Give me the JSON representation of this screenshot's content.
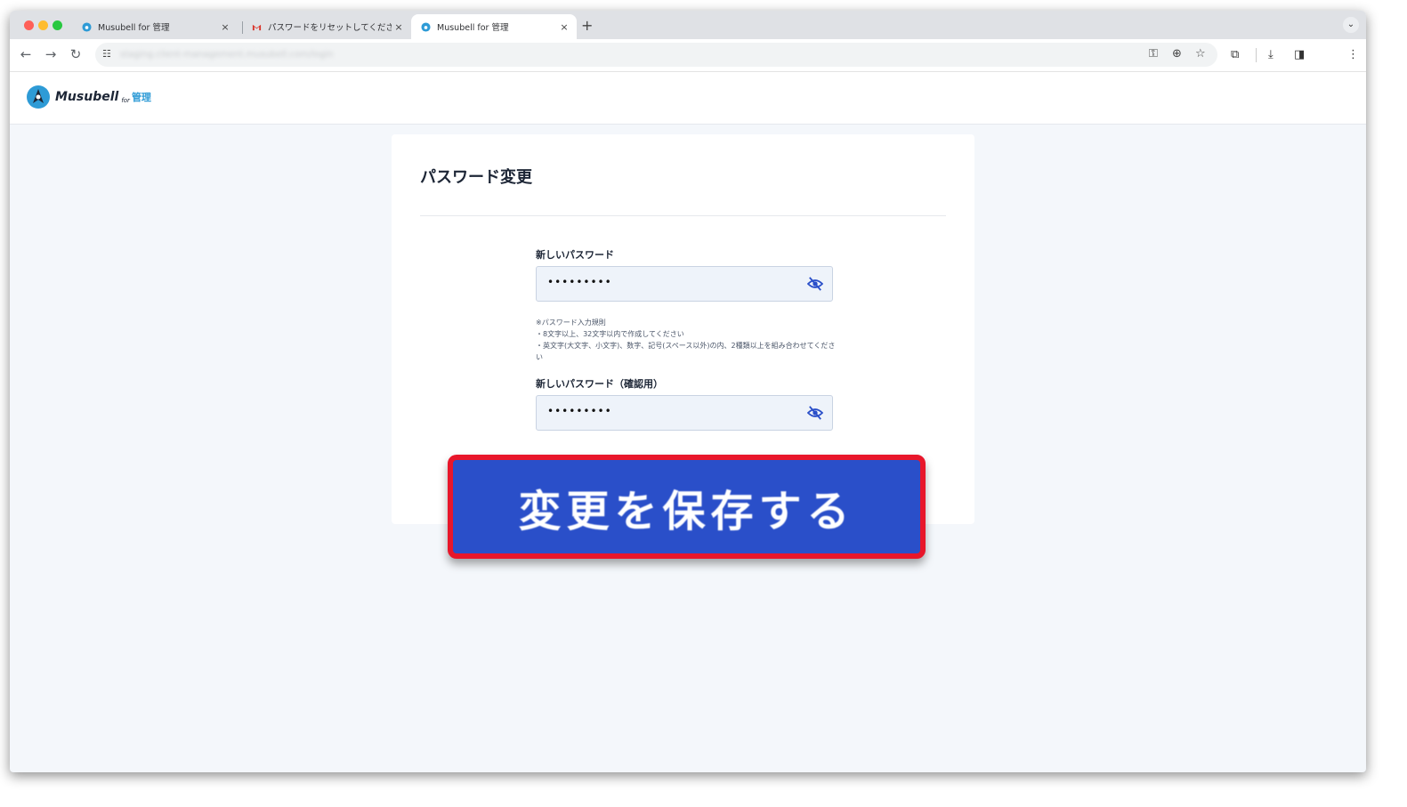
{
  "browser": {
    "tabs": [
      {
        "title": "Musubell for 管理",
        "active": false
      },
      {
        "title": "パスワードをリセットしてくださ",
        "active": false
      },
      {
        "title": "Musubell for 管理",
        "active": true
      }
    ],
    "new_tab_label": "+",
    "close_label": "×",
    "url": "staging.client-management.musubell.com/login"
  },
  "app": {
    "logo_name": "Musubell",
    "logo_for": "for",
    "logo_kanri": "管理"
  },
  "form": {
    "title": "パスワード変更",
    "new_password_label": "新しいパスワード",
    "new_password_value": "•••••••••",
    "rules": [
      "※パスワード入力規則",
      "・8文字以上、32文字以内で作成してください",
      "・英文字(大文字、小文字)、数字、記号(スペース以外)の内、2種類以上を組み合わせてください"
    ],
    "confirm_password_label": "新しいパスワード（確認用）",
    "confirm_password_value": "•••••••••",
    "save_button_label": "変更を保存する"
  },
  "colors": {
    "accent": "#2a4fc9",
    "highlight": "#e8162a",
    "brand": "#2e9bd6"
  }
}
